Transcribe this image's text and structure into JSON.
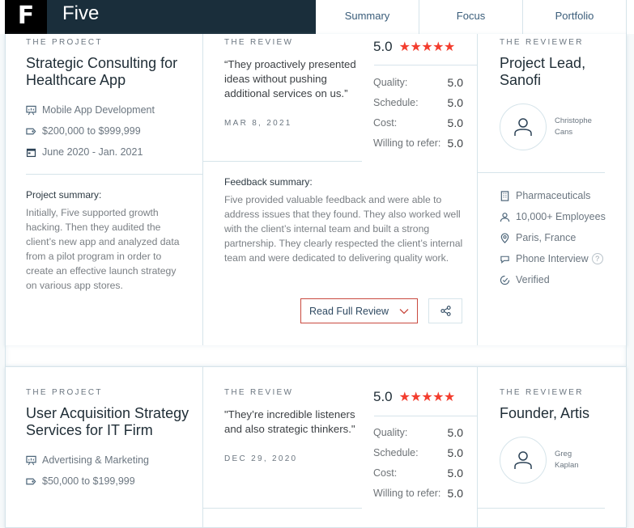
{
  "header": {
    "logo_letter": "F",
    "company_name": "Five",
    "tabs": [
      {
        "label": "Summary"
      },
      {
        "label": "Focus"
      },
      {
        "label": "Portfolio"
      }
    ]
  },
  "colors": {
    "brand_dark": "#1a2e3b",
    "star": "#f33d2e",
    "button_border": "#c94a3f",
    "divider": "#d6e4ea"
  },
  "reviews": [
    {
      "project": {
        "eyebrow": "THE PROJECT",
        "title": "Strategic Consulting for Healthcare App",
        "service": "Mobile App Development",
        "budget": "$200,000 to $999,999",
        "timeline": "June 2020 - Jan. 2021",
        "summary_label": "Project summary:",
        "summary": "Initially, Five supported growth hacking. Then they audited the client’s new app and analyzed data from a pilot program in order to create an effective launch strategy on various app stores."
      },
      "review": {
        "eyebrow": "THE REVIEW",
        "quote": "“They proactively presented ideas without pushing additional services on us.”",
        "date": "MAR 8, 2021",
        "overall": "5.0",
        "stars": 5,
        "ratings": [
          {
            "label": "Quality:",
            "value": "5.0"
          },
          {
            "label": "Schedule:",
            "value": "5.0"
          },
          {
            "label": "Cost:",
            "value": "5.0"
          },
          {
            "label": "Willing to refer:",
            "value": "5.0"
          }
        ],
        "feedback_label": "Feedback summary:",
        "feedback": "Five provided valuable feedback and were able to address issues that they found. They also worked well with the client’s internal team and built a strong partnership. They clearly respected the client’s internal team and were dedicated to delivering quality work.",
        "read_button": "Read Full Review"
      },
      "reviewer": {
        "eyebrow": "THE REVIEWER",
        "title": "Project Lead, Sanofi",
        "first_name": "Christophe",
        "last_name": "Cans",
        "industry": "Pharmaceuticals",
        "size": "10,000+ Employees",
        "location": "Paris, France",
        "interview": "Phone Interview",
        "verified": "Verified"
      }
    },
    {
      "project": {
        "eyebrow": "THE PROJECT",
        "title": "User Acquisition Strategy Services for IT Firm",
        "service": "Advertising & Marketing",
        "budget": "$50,000 to $199,999"
      },
      "review": {
        "eyebrow": "THE REVIEW",
        "quote": "\"They’re incredible listeners and also strategic thinkers.\"",
        "date": "DEC 29, 2020",
        "overall": "5.0",
        "stars": 5,
        "ratings": [
          {
            "label": "Quality:",
            "value": "5.0"
          },
          {
            "label": "Schedule:",
            "value": "5.0"
          },
          {
            "label": "Cost:",
            "value": "5.0"
          },
          {
            "label": "Willing to refer:",
            "value": "5.0"
          }
        ]
      },
      "reviewer": {
        "eyebrow": "THE REVIEWER",
        "title": "Founder, Artis",
        "first_name": "Greg",
        "last_name": "Kaplan"
      }
    }
  ]
}
